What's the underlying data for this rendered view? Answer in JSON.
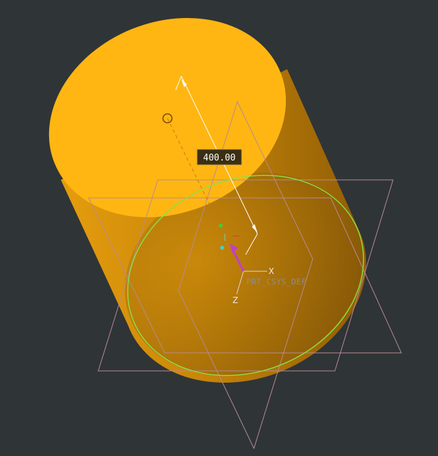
{
  "viewport": {
    "background": "#2f3437"
  },
  "model": {
    "cylinder_color": "#ffb612",
    "cylinder_side_color": "#d48d08",
    "sketch_circle_color": "#86e24a",
    "datum_plane_color": "#b88a92"
  },
  "dimension": {
    "value": "400.00",
    "label_bg": "#3a2f12",
    "label_text_color": "#ffffff"
  },
  "csys": {
    "name": "PRT_CSYS_DEF",
    "x_label": "X",
    "z_label": "Z"
  }
}
